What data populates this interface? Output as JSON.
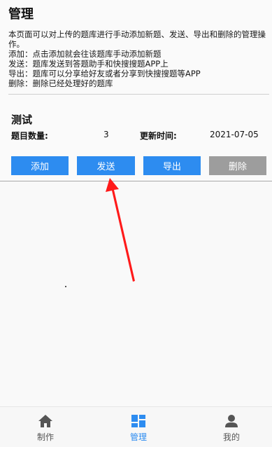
{
  "header": {
    "title": "管理"
  },
  "description": {
    "lines": [
      "本页面可以对上传的题库进行手动添加新题、发送、导出和删除的管理操作。",
      "添加：点击添加就会往该题库手动添加新题",
      "发送：题库发送到答题助手和快搜搜题APP上",
      "导出：题库可以分享给好友或者分享到快搜搜题等APP",
      "删除：删除已经处理好的题库"
    ]
  },
  "bank": {
    "name": "测试",
    "count_label": "题目数量:",
    "count_value": "3",
    "updated_label": "更新时间:",
    "updated_value": "2021-07-05"
  },
  "actions": {
    "add": "添加",
    "send": "发送",
    "export": "导出",
    "delete": "删除"
  },
  "colors": {
    "accent": "#2d8cf0",
    "disabled": "#9d9d9d",
    "arrow": "#ff1a1a"
  },
  "tabbar": {
    "items": [
      {
        "label": "制作",
        "icon": "home-icon"
      },
      {
        "label": "管理",
        "icon": "grid-icon",
        "active": true
      },
      {
        "label": "我的",
        "icon": "person-icon"
      }
    ]
  }
}
